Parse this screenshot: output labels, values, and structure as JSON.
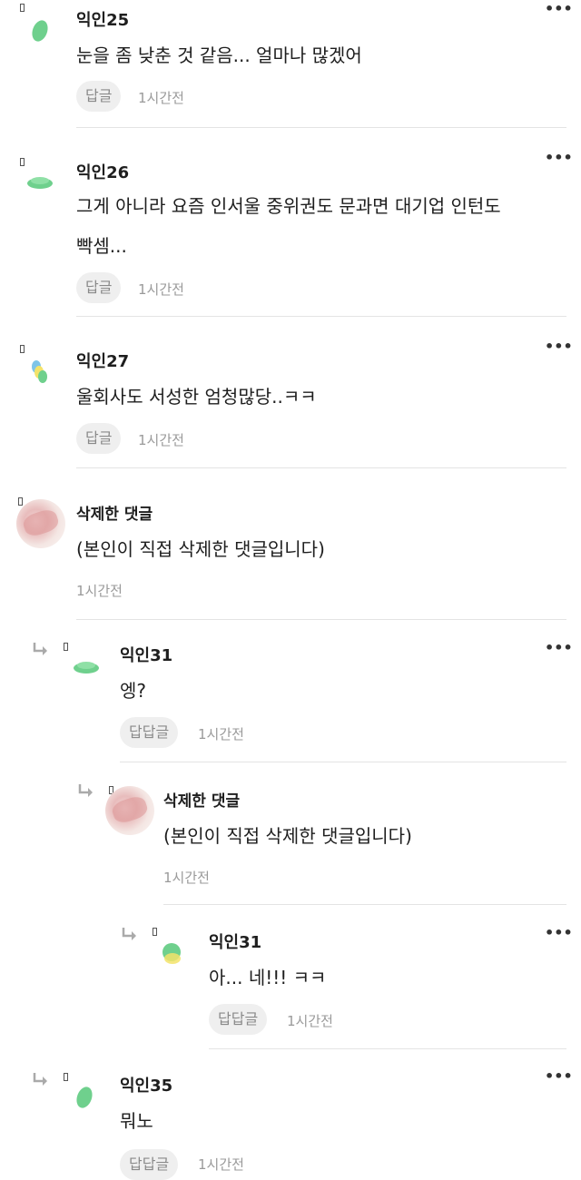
{
  "menu_icon": "more-dots-icon",
  "reply_icon": "reply-arrow-icon",
  "comments": [
    {
      "name": "익인25",
      "text": "눈을 좀 낮춘 것 같음... 얼마나 많겠어",
      "reply": "답글",
      "time": "1시간전",
      "more": "•••"
    },
    {
      "name": "익인26",
      "text_line1": "그게 아니라 요즘 인서울 중위권도 문과면 대기업 인턴도",
      "text_line2": "빡셈...",
      "reply": "답글",
      "time": "1시간전",
      "more": "•••"
    },
    {
      "name": "익인27",
      "text": "울회사도 서성한 엄청많당..ㅋㅋ",
      "reply": "답글",
      "time": "1시간전",
      "more": "•••"
    },
    {
      "name": "삭제한 댓글",
      "text": "(본인이 직접 삭제한 댓글입니다)",
      "time": "1시간전"
    },
    {
      "name": "익인31",
      "text": "엥?",
      "reply": "답답글",
      "time": "1시간전",
      "more": "•••"
    },
    {
      "name": "삭제한 댓글",
      "text": "(본인이 직접 삭제한 댓글입니다)",
      "time": "1시간전"
    },
    {
      "name": "익인31",
      "text": "아... 네!!! ㅋㅋ",
      "reply": "답답글",
      "time": "1시간전",
      "more": "•••"
    },
    {
      "name": "익인35",
      "text": "뭐노",
      "reply": "답답글",
      "time": "1시간전",
      "more": "•••"
    }
  ]
}
